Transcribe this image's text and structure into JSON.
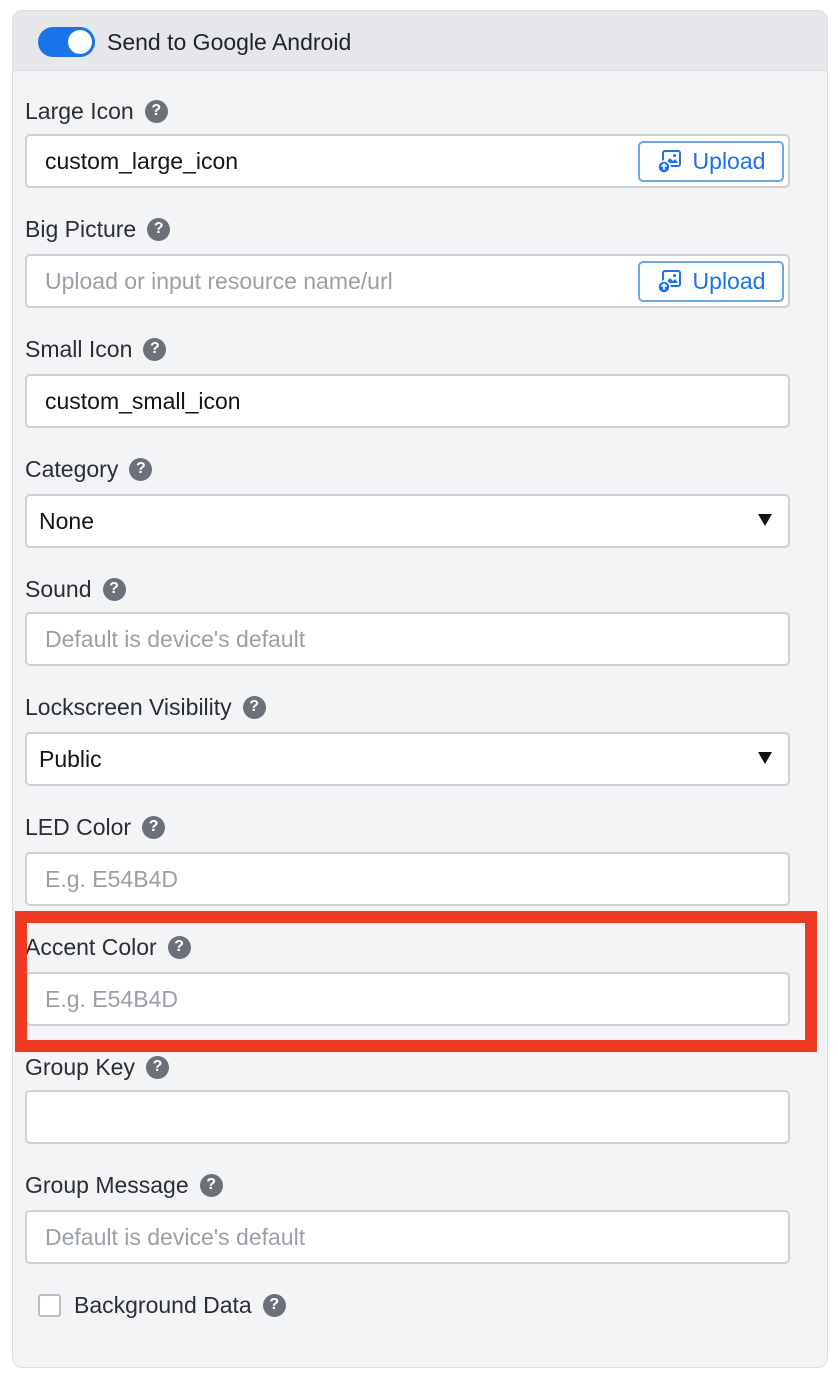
{
  "header": {
    "toggle_on": true,
    "label": "Send to Google Android"
  },
  "help_glyph": "?",
  "fields": {
    "large_icon": {
      "label": "Large Icon",
      "value": "custom_large_icon",
      "upload_label": "Upload"
    },
    "big_picture": {
      "label": "Big Picture",
      "placeholder": "Upload or input resource name/url",
      "upload_label": "Upload"
    },
    "small_icon": {
      "label": "Small Icon",
      "value": "custom_small_icon"
    },
    "category": {
      "label": "Category",
      "selected": "None"
    },
    "sound": {
      "label": "Sound",
      "placeholder": "Default is device's default"
    },
    "lockscreen_visibility": {
      "label": "Lockscreen Visibility",
      "selected": "Public"
    },
    "led_color": {
      "label": "LED Color",
      "placeholder": "E.g. E54B4D"
    },
    "accent_color": {
      "label": "Accent Color",
      "placeholder": "E.g. E54B4D"
    },
    "group_key": {
      "label": "Group Key",
      "value": ""
    },
    "group_message": {
      "label": "Group Message",
      "placeholder": "Default is device's default"
    },
    "background_data": {
      "label": "Background Data",
      "checked": false
    }
  },
  "colors": {
    "toggle_accent": "#1a73e8",
    "upload_text": "#1a73e8",
    "highlight_border": "#ee3a22"
  },
  "icons": {
    "help": "help-circle-icon",
    "upload": "image-upload-icon",
    "dropdown": "caret-down-icon"
  }
}
